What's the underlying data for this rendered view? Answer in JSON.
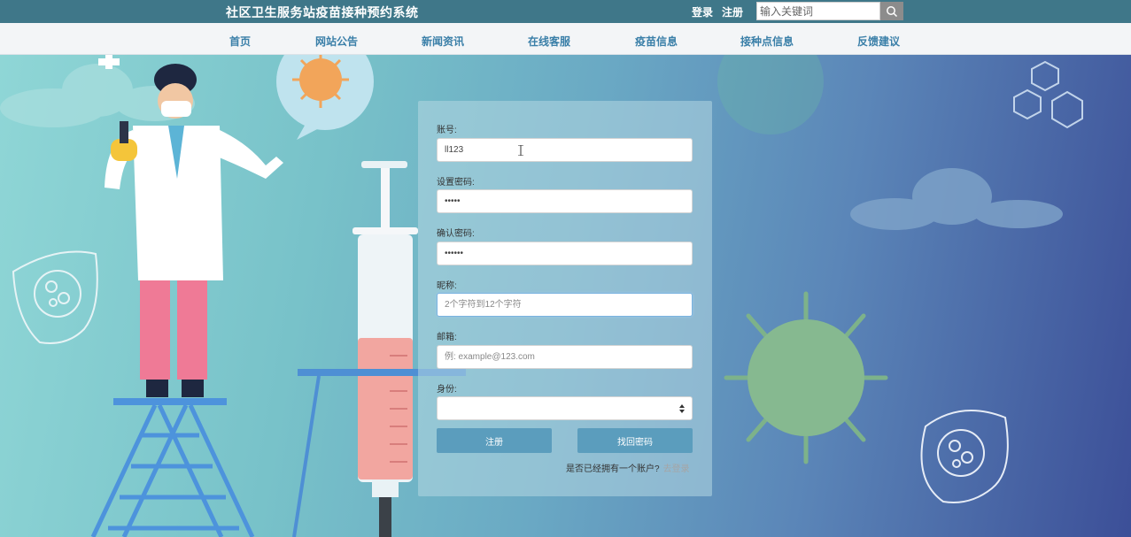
{
  "header": {
    "title": "社区卫生服务站疫苗接种预约系统",
    "login_label": "登录",
    "register_label": "注册",
    "search_placeholder": "输入关键词"
  },
  "nav": {
    "items": [
      "首页",
      "网站公告",
      "新闻资讯",
      "在线客服",
      "疫苗信息",
      "接种点信息",
      "反馈建议"
    ]
  },
  "form": {
    "account_label": "账号:",
    "account_value": "ll123",
    "password_label": "设置密码:",
    "password_value": "•••••",
    "confirm_label": "确认密码:",
    "confirm_value": "••••••",
    "nickname_label": "昵称:",
    "nickname_placeholder": "2个字符到12个字符",
    "email_label": "邮箱:",
    "email_placeholder": "例: example@123.com",
    "identity_label": "身份:",
    "identity_value": "",
    "register_button": "注册",
    "recover_button": "找回密码",
    "have_account_text": "是否已经拥有一个账户?",
    "login_link": "去登录"
  },
  "colors": {
    "topbar": "#3f7789",
    "nav_text": "#3a7fa8",
    "button": "#5b9dbd"
  }
}
